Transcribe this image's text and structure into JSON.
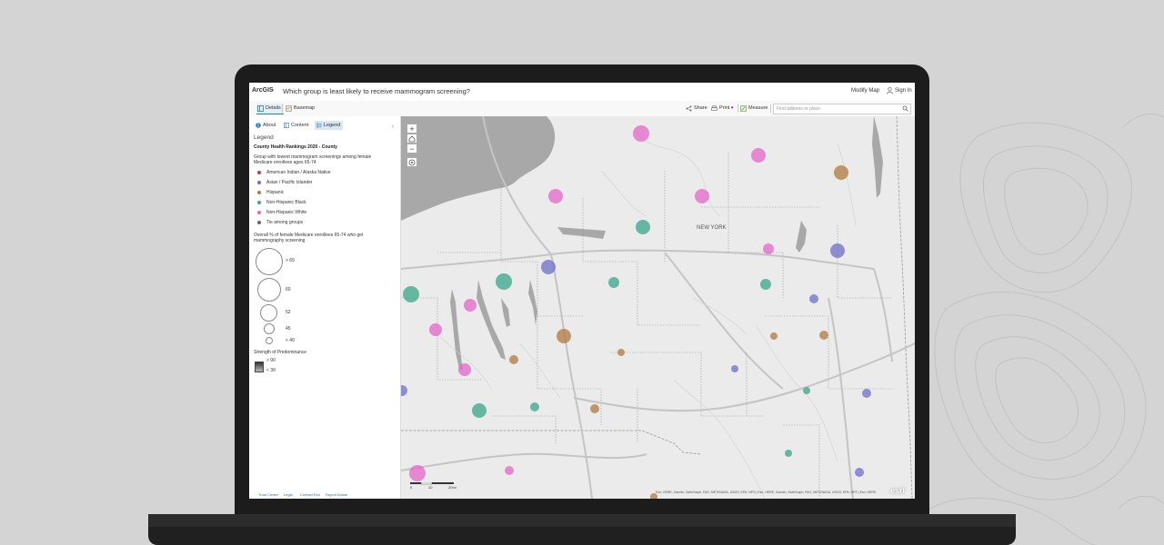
{
  "colors": {
    "american_indian": "#c0366b",
    "asian": "#6e6ec8",
    "hispanic": "#b07a3e",
    "black": "#3aa68a",
    "white": "#e466c8",
    "tie": "#666666",
    "accent": "#2b7bc0"
  },
  "header": {
    "logo": "ArcGIS",
    "map_title": "Which group is least likely to receive mammogram screening?",
    "modify_map": "Modify Map",
    "sign_in": "Sign In"
  },
  "toolbar": {
    "details": "Details",
    "basemap": "Basemap",
    "share": "Share",
    "print": "Print",
    "measure": "Measure",
    "search_placeholder": "Find address or place"
  },
  "sidebar": {
    "tabs": [
      "About",
      "Content",
      "Legend"
    ],
    "legend_heading": "Legend",
    "layer_title": "County Health Rankings 2020 - County",
    "field_label": "Group with lowest mammogram screenings among female Medicare enrollees ages 65-74",
    "categories": [
      {
        "label": "American Indian / Alaska Native",
        "color_key": "american_indian"
      },
      {
        "label": "Asian / Pacific Islander",
        "color_key": "asian"
      },
      {
        "label": "Hispanic",
        "color_key": "hispanic"
      },
      {
        "label": "Non-Hispanic Black",
        "color_key": "black"
      },
      {
        "label": "Non-Hispanic White",
        "color_key": "white"
      },
      {
        "label": "Tie among groups",
        "color_key": "tie"
      }
    ],
    "size_label": "Overall % of female Medicare enrollees 65-74 who get mammography screening",
    "size_classes": [
      "> 65",
      "60",
      "52",
      "45",
      "< 40"
    ],
    "strength_label": "Strength of Predominance",
    "strength_high": "> 90",
    "strength_low": "< 30",
    "footer_links": [
      "Trust Center",
      "Legal",
      "Contact Esri",
      "Report Abuse"
    ]
  },
  "map": {
    "zoom_in": "+",
    "zoom_out": "−",
    "state_label": "NEW YORK",
    "scale_labels": [
      "0",
      "10",
      "20mi"
    ],
    "attribution": "Esri, HERE, Garmin, SafeGraph, FAO, METI/NASA, USGS, EPA, NPS | Esri, HERE, Garmin, SafeGraph, FAO, METI/NASA, USGS, EPA, NPS | Esri, HERE",
    "esri_logo": "esri"
  }
}
